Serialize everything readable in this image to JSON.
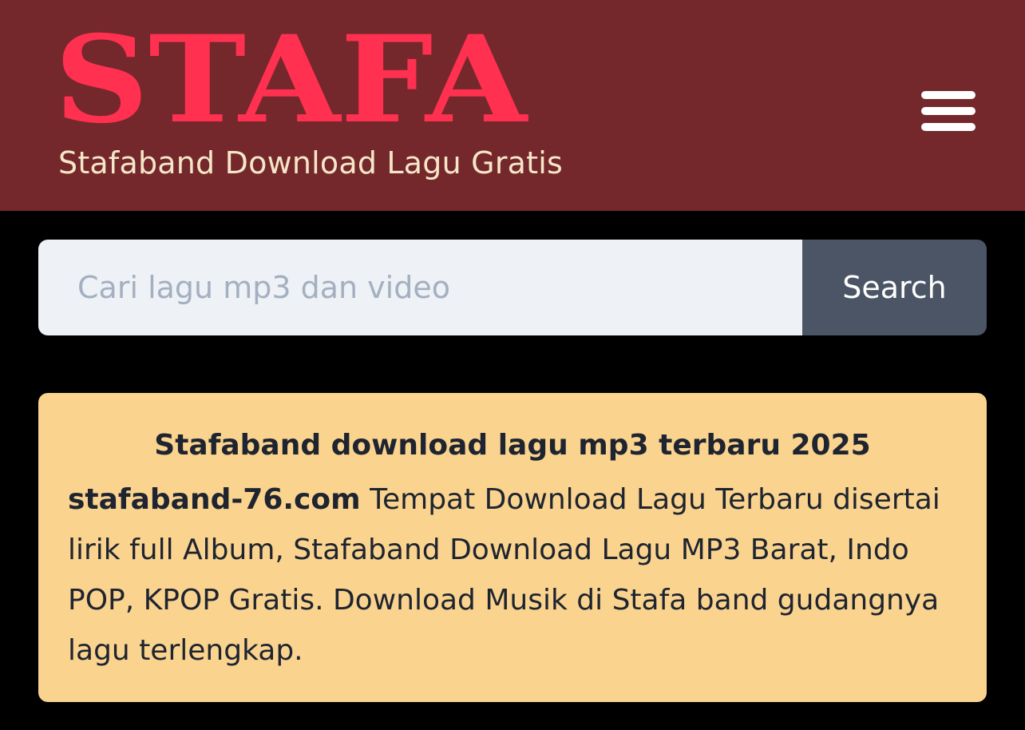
{
  "header": {
    "logo_text": "STAFA",
    "tagline": "Stafaband Download Lagu Gratis",
    "menu_icon": "hamburger-menu-icon"
  },
  "search": {
    "placeholder": "Cari lagu mp3 dan video",
    "value": "",
    "button_label": "Search"
  },
  "info": {
    "title": "Stafaband download lagu mp3 terbaru 2025",
    "site_name": "stafaband-76.com",
    "description": " Tempat Download Lagu Terbaru disertai lirik full Album, Stafaband Download Lagu MP3 Barat, Indo POP, KPOP Gratis. Download Musik di Stafa band gudangnya lagu terlengkap."
  },
  "colors": {
    "header_bg": "#74282b",
    "logo_red": "#ff3050",
    "tagline": "#f6e6c9",
    "page_bg": "#000000",
    "input_bg": "#eef2f6",
    "button_bg": "#4b5565",
    "card_bg": "#fad38e",
    "card_text": "#1e2430"
  }
}
